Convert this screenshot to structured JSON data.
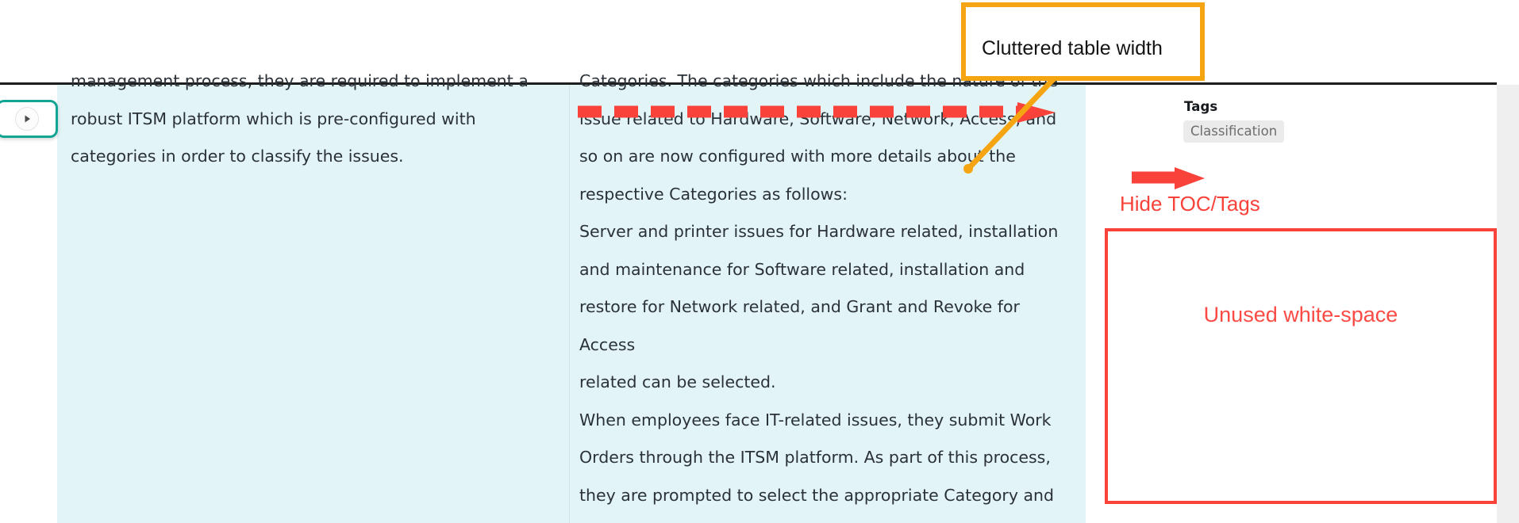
{
  "document": {
    "left_column_text": "management process, they are required to implement a\nrobust ITSM platform which is pre-configured with\ncategories in order to classify the issues.",
    "right_column_text": "Categories. The categories which include the nature of the\nissue related to Hardware, Software, Network, Access, and\nso on are now configured with more details about the\nrespective Categories as follows:\nServer and printer issues for Hardware related, installation\nand maintenance for Software related, installation and\nrestore for Network related, and Grant and Revoke for Access\nrelated can be selected.\nWhen employees face IT-related issues, they submit Work\nOrders through the ITSM platform. As part of this process,\nthey are prompted to select the appropriate Category and",
    "highlight_color": "#e3f4f7",
    "text_color": "#2a3138"
  },
  "toc_toggle": {
    "icon": "play-triangle-icon",
    "border_color": "#12a594"
  },
  "tags_panel": {
    "title": "Tags",
    "chips": [
      {
        "label": "Classification"
      }
    ]
  },
  "annotations": {
    "callout_yellow": {
      "text": "Cluttered table width",
      "border_color": "#f5a511"
    },
    "dashed_arrow": {
      "name": "dashed-arrow-right-icon",
      "color": "#f9423a"
    },
    "small_arrow": {
      "name": "arrow-right-icon",
      "color": "#f9423a"
    },
    "label_hide": {
      "text": "Hide TOC/Tags",
      "color": "#f9423a"
    },
    "box_unused": {
      "text": "Unused white-space",
      "border_color": "#f9423a",
      "text_color": "#fb4b44"
    }
  }
}
